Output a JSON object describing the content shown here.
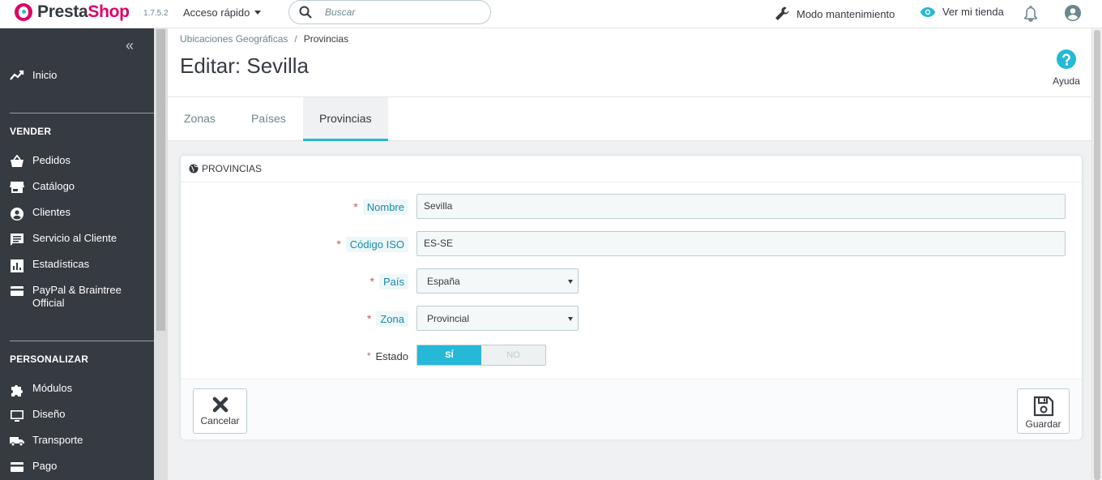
{
  "header": {
    "brand_presta": "Presta",
    "brand_shop": "Shop",
    "version": "1.7.5.2",
    "quick_access": "Acceso rápido",
    "search_placeholder": "Buscar",
    "maintenance": "Modo mantenimiento",
    "view_store": "Ver mi tienda"
  },
  "sidebar": {
    "collapse": "«",
    "home": "Inicio",
    "section_sell": "VENDER",
    "sell_items": [
      "Pedidos",
      "Catálogo",
      "Clientes",
      "Servicio al Cliente",
      "Estadísticas",
      "PayPal & Braintree Official"
    ],
    "section_customize": "PERSONALIZAR",
    "customize_items": [
      "Módulos",
      "Diseño",
      "Transporte",
      "Pago"
    ]
  },
  "breadcrumb": {
    "parent": "Ubicaciones Geográficas",
    "separator": "/",
    "current": "Provincias"
  },
  "page": {
    "title": "Editar: Sevilla",
    "help": "Ayuda"
  },
  "tabs": [
    "Zonas",
    "Países",
    "Provincias"
  ],
  "active_tab": "Provincias",
  "panel": {
    "title": "PROVINCIAS",
    "fields": {
      "name_label": "Nombre",
      "name_value": "Sevilla",
      "iso_label": "Código ISO",
      "iso_value": "ES-SE",
      "country_label": "País",
      "country_value": "España",
      "zone_label": "Zona",
      "zone_value": "Provincial",
      "status_label": "Estado",
      "status_yes": "SÍ",
      "status_no": "NO"
    },
    "status_on": true,
    "required_marker": "*",
    "cancel": "Cancelar",
    "save": "Guardar"
  },
  "colors": {
    "accent": "#25b9d7",
    "brand_pink": "#df0067",
    "sidebar_bg": "#363a41",
    "required": "#c05c67"
  }
}
